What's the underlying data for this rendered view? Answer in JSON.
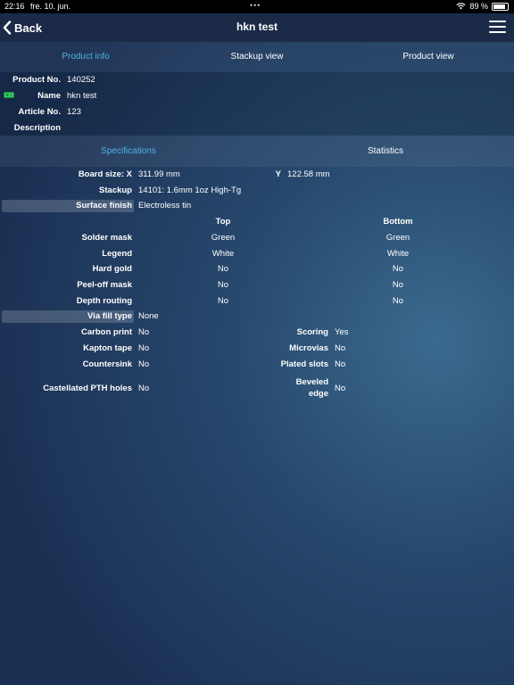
{
  "status_bar": {
    "time": "22:16",
    "date": "fre. 10. jun.",
    "battery": "89 %",
    "battery_level": 0.89
  },
  "nav": {
    "back_label": "Back",
    "title": "hkn test"
  },
  "top_tabs": [
    {
      "label": "Product info",
      "active": true
    },
    {
      "label": "Stackup view",
      "active": false
    },
    {
      "label": "Product view",
      "active": false
    }
  ],
  "product": {
    "product_no_label": "Product No.",
    "product_no": "140252",
    "name_label": "Name",
    "name": "hkn test",
    "article_no_label": "Article No.",
    "article_no": "123",
    "description_label": "Description",
    "description": ""
  },
  "spec_tabs": [
    {
      "label": "Specifications",
      "active": true
    },
    {
      "label": "Statistics",
      "active": false
    }
  ],
  "specs": {
    "board_size_x_label": "Board size: X",
    "board_size_x": "311.99 mm",
    "board_size_y_label": "Y",
    "board_size_y": "122.58 mm",
    "stackup_label": "Stackup",
    "stackup": "14101: 1.6mm 1oz High-Tg",
    "surface_finish_label": "Surface finish",
    "surface_finish": "Electroless tin",
    "col_top": "Top",
    "col_bottom": "Bottom",
    "sided_rows": [
      {
        "label": "Solder mask",
        "top": "Green",
        "bottom": "Green"
      },
      {
        "label": "Legend",
        "top": "White",
        "bottom": "White"
      },
      {
        "label": "Hard gold",
        "top": "No",
        "bottom": "No"
      },
      {
        "label": "Peel-off mask",
        "top": "No",
        "bottom": "No"
      },
      {
        "label": "Depth routing",
        "top": "No",
        "bottom": "No"
      }
    ],
    "via_fill_label": "Via fill type",
    "via_fill": "None",
    "carbon_print_label": "Carbon print",
    "carbon_print": "No",
    "scoring_label": "Scoring",
    "scoring": "Yes",
    "kapton_label": "Kapton tape",
    "kapton": "No",
    "microvias_label": "Microvias",
    "microvias": "No",
    "countersink_label": "Countersink",
    "countersink": "No",
    "plated_slots_label": "Plated slots",
    "plated_slots": "No",
    "castellated_label": "Castellated PTH holes",
    "castellated": "No",
    "beveled_label_1": "Beveled",
    "beveled_label_2": "edge",
    "beveled": "No"
  },
  "colors": {
    "accent": "#4fb3e6",
    "nav_bg": "#1b2b47",
    "pcb_icon": "#39d16a"
  },
  "icons": {
    "back": "chevron-left-icon",
    "menu": "hamburger-menu-icon",
    "wifi": "wifi-icon",
    "battery": "battery-icon",
    "product": "pcb-board-icon"
  }
}
